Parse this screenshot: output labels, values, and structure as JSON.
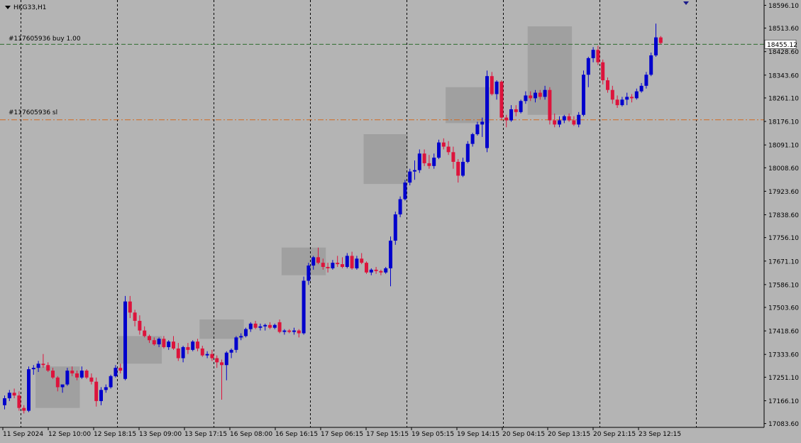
{
  "symbol_label": "HKG33,H1",
  "order_labels": {
    "buy": "#117605936 buy 1.00",
    "sl": "#117605936 sl"
  },
  "current_price_label": "18455.12",
  "colors": {
    "background": "#b4b4b4",
    "bull": "#0000cc",
    "bear": "#dc143c",
    "buy_line": "#2e6b2e",
    "sl_line": "#d2691e",
    "box": "#a0a0a0",
    "grid": "#000000"
  },
  "chart_data": {
    "type": "candlestick",
    "title": "HKG33,H1",
    "ylim": [
      17080,
      18605
    ],
    "y_ticks": [
      "18596.10",
      "18513.60",
      "18428.60",
      "18343.60",
      "18261.10",
      "18176.10",
      "18091.10",
      "18008.60",
      "17923.60",
      "17838.60",
      "17756.10",
      "17671.10",
      "17586.10",
      "17503.60",
      "17418.60",
      "17333.60",
      "17251.10",
      "17166.10",
      "17083.60"
    ],
    "x_ticks": [
      "11 Sep 2024",
      "12 Sep 10:00",
      "12 Sep 18:15",
      "13 Sep 09:00",
      "13 Sep 17:15",
      "16 Sep 08:00",
      "16 Sep 16:15",
      "17 Sep 06:15",
      "17 Sep 15:15",
      "19 Sep 05:15",
      "19 Sep 14:15",
      "20 Sep 04:15",
      "20 Sep 13:15",
      "20 Sep 21:15",
      "23 Sep 12:15"
    ],
    "buy_level": 18455.12,
    "sl_level": 18182,
    "candles": [
      [
        17150,
        17185,
        17135,
        17175
      ],
      [
        17175,
        17205,
        17165,
        17195
      ],
      [
        17195,
        17210,
        17175,
        17185
      ],
      [
        17185,
        17200,
        17130,
        17140
      ],
      [
        17140,
        17150,
        17120,
        17130
      ],
      [
        17130,
        17290,
        17125,
        17280
      ],
      [
        17280,
        17295,
        17260,
        17285
      ],
      [
        17285,
        17310,
        17270,
        17300
      ],
      [
        17300,
        17335,
        17285,
        17295
      ],
      [
        17295,
        17305,
        17270,
        17275
      ],
      [
        17275,
        17285,
        17245,
        17250
      ],
      [
        17250,
        17255,
        17200,
        17215
      ],
      [
        17215,
        17225,
        17195,
        17225
      ],
      [
        17225,
        17285,
        17220,
        17275
      ],
      [
        17275,
        17290,
        17255,
        17265
      ],
      [
        17265,
        17275,
        17240,
        17250
      ],
      [
        17250,
        17290,
        17245,
        17275
      ],
      [
        17275,
        17280,
        17245,
        17250
      ],
      [
        17250,
        17265,
        17225,
        17235
      ],
      [
        17235,
        17250,
        17145,
        17165
      ],
      [
        17165,
        17215,
        17150,
        17205
      ],
      [
        17205,
        17225,
        17195,
        17215
      ],
      [
        17215,
        17260,
        17210,
        17255
      ],
      [
        17255,
        17295,
        17250,
        17285
      ],
      [
        17285,
        17300,
        17265,
        17275
      ],
      [
        17245,
        17545,
        17240,
        17525
      ],
      [
        17525,
        17545,
        17465,
        17485
      ],
      [
        17485,
        17495,
        17435,
        17455
      ],
      [
        17455,
        17475,
        17405,
        17420
      ],
      [
        17420,
        17435,
        17395,
        17400
      ],
      [
        17400,
        17405,
        17375,
        17385
      ],
      [
        17385,
        17395,
        17365,
        17370
      ],
      [
        17370,
        17395,
        17360,
        17390
      ],
      [
        17390,
        17400,
        17355,
        17360
      ],
      [
        17360,
        17385,
        17350,
        17380
      ],
      [
        17380,
        17400,
        17350,
        17355
      ],
      [
        17355,
        17375,
        17310,
        17320
      ],
      [
        17320,
        17365,
        17305,
        17360
      ],
      [
        17360,
        17375,
        17335,
        17350
      ],
      [
        17350,
        17385,
        17345,
        17380
      ],
      [
        17380,
        17390,
        17345,
        17355
      ],
      [
        17355,
        17365,
        17325,
        17330
      ],
      [
        17330,
        17345,
        17320,
        17335
      ],
      [
        17335,
        17350,
        17310,
        17320
      ],
      [
        17320,
        17330,
        17285,
        17305
      ],
      [
        17305,
        17315,
        17170,
        17295
      ],
      [
        17295,
        17345,
        17240,
        17340
      ],
      [
        17340,
        17355,
        17320,
        17350
      ],
      [
        17350,
        17400,
        17340,
        17395
      ],
      [
        17395,
        17410,
        17385,
        17400
      ],
      [
        17400,
        17430,
        17395,
        17425
      ],
      [
        17425,
        17450,
        17415,
        17445
      ],
      [
        17445,
        17455,
        17425,
        17430
      ],
      [
        17430,
        17445,
        17420,
        17435
      ],
      [
        17435,
        17445,
        17420,
        17440
      ],
      [
        17440,
        17450,
        17425,
        17430
      ],
      [
        17430,
        17445,
        17425,
        17440
      ],
      [
        17450,
        17460,
        17410,
        17415
      ],
      [
        17415,
        17425,
        17405,
        17420
      ],
      [
        17420,
        17425,
        17410,
        17415
      ],
      [
        17415,
        17430,
        17405,
        17420
      ],
      [
        17420,
        17425,
        17395,
        17410
      ],
      [
        17410,
        17615,
        17405,
        17600
      ],
      [
        17600,
        17665,
        17585,
        17655
      ],
      [
        17655,
        17690,
        17640,
        17685
      ],
      [
        17685,
        17720,
        17660,
        17665
      ],
      [
        17665,
        17680,
        17640,
        17650
      ],
      [
        17650,
        17665,
        17630,
        17645
      ],
      [
        17645,
        17675,
        17640,
        17665
      ],
      [
        17665,
        17690,
        17650,
        17660
      ],
      [
        17660,
        17685,
        17645,
        17650
      ],
      [
        17650,
        17700,
        17645,
        17690
      ],
      [
        17690,
        17705,
        17640,
        17645
      ],
      [
        17645,
        17690,
        17640,
        17680
      ],
      [
        17680,
        17700,
        17660,
        17665
      ],
      [
        17665,
        17670,
        17625,
        17630
      ],
      [
        17630,
        17645,
        17620,
        17640
      ],
      [
        17640,
        17650,
        17625,
        17635
      ],
      [
        17635,
        17640,
        17620,
        17630
      ],
      [
        17630,
        17650,
        17625,
        17645
      ],
      [
        17645,
        17760,
        17580,
        17745
      ],
      [
        17745,
        17850,
        17730,
        17840
      ],
      [
        17840,
        17905,
        17830,
        17895
      ],
      [
        17895,
        17965,
        17890,
        17955
      ],
      [
        17955,
        18005,
        17945,
        17995
      ],
      [
        17995,
        18035,
        17965,
        18000
      ],
      [
        18000,
        18075,
        17990,
        18060
      ],
      [
        18060,
        18075,
        18015,
        18025
      ],
      [
        18025,
        18055,
        18005,
        18015
      ],
      [
        18015,
        18060,
        18005,
        18045
      ],
      [
        18045,
        18110,
        18040,
        18100
      ],
      [
        18100,
        18115,
        18075,
        18085
      ],
      [
        18085,
        18105,
        18055,
        18065
      ],
      [
        18065,
        18085,
        18005,
        18030
      ],
      [
        18030,
        18040,
        17955,
        17980
      ],
      [
        17980,
        18045,
        17975,
        18030
      ],
      [
        18030,
        18105,
        18025,
        18095
      ],
      [
        18095,
        18135,
        18085,
        18130
      ],
      [
        18130,
        18175,
        18125,
        18165
      ],
      [
        18165,
        18190,
        18120,
        18175
      ],
      [
        18080,
        18360,
        18065,
        18340
      ],
      [
        18340,
        18355,
        18270,
        18275
      ],
      [
        18275,
        18325,
        18255,
        18320
      ],
      [
        18320,
        18325,
        18180,
        18190
      ],
      [
        18190,
        18200,
        18155,
        18180
      ],
      [
        18180,
        18235,
        18175,
        18220
      ],
      [
        18220,
        18235,
        18195,
        18210
      ],
      [
        18210,
        18255,
        18205,
        18250
      ],
      [
        18250,
        18285,
        18240,
        18270
      ],
      [
        18270,
        18285,
        18250,
        18260
      ],
      [
        18260,
        18290,
        18245,
        18280
      ],
      [
        18280,
        18290,
        18255,
        18265
      ],
      [
        18265,
        18305,
        18255,
        18290
      ],
      [
        18290,
        18300,
        18165,
        18180
      ],
      [
        18180,
        18205,
        18155,
        18165
      ],
      [
        18165,
        18195,
        18155,
        18180
      ],
      [
        18180,
        18200,
        18170,
        18195
      ],
      [
        18195,
        18205,
        18175,
        18180
      ],
      [
        18180,
        18195,
        18160,
        18165
      ],
      [
        18165,
        18210,
        18155,
        18200
      ],
      [
        18200,
        18360,
        18195,
        18345
      ],
      [
        18345,
        18410,
        18300,
        18405
      ],
      [
        18405,
        18445,
        18390,
        18435
      ],
      [
        18435,
        18450,
        18380,
        18390
      ],
      [
        18390,
        18400,
        18310,
        18325
      ],
      [
        18325,
        18335,
        18280,
        18290
      ],
      [
        18290,
        18305,
        18240,
        18255
      ],
      [
        18255,
        18270,
        18225,
        18235
      ],
      [
        18235,
        18265,
        18230,
        18255
      ],
      [
        18255,
        18280,
        18235,
        18265
      ],
      [
        18265,
        18275,
        18245,
        18260
      ],
      [
        18260,
        18295,
        18255,
        18285
      ],
      [
        18285,
        18315,
        18280,
        18305
      ],
      [
        18305,
        18355,
        18295,
        18345
      ],
      [
        18345,
        18425,
        18340,
        18415
      ],
      [
        18415,
        18530,
        18410,
        18480
      ],
      [
        18480,
        18485,
        18455,
        18460
      ]
    ],
    "boxes": [
      {
        "t0": 7,
        "t1": 15,
        "low": 17140,
        "high": 17290
      },
      {
        "t0": 24,
        "t1": 32,
        "low": 17300,
        "high": 17400
      },
      {
        "t0": 41,
        "t1": 49,
        "low": 17390,
        "high": 17460
      },
      {
        "t0": 58,
        "t1": 66,
        "low": 17620,
        "high": 17720
      },
      {
        "t0": 75,
        "t1": 83,
        "low": 17950,
        "high": 18130
      },
      {
        "t0": 92,
        "t1": 100,
        "low": 18170,
        "high": 18300
      },
      {
        "t0": 109,
        "t1": 117,
        "low": 18200,
        "high": 18520
      }
    ]
  }
}
